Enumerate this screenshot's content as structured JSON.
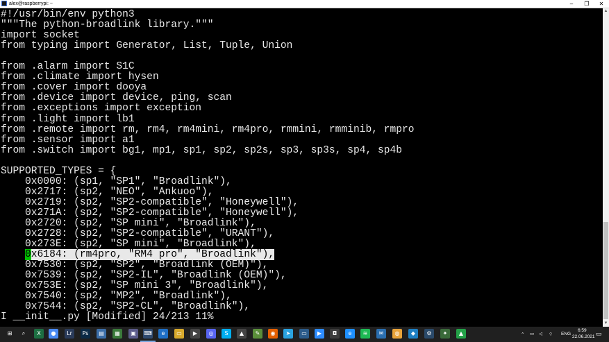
{
  "window": {
    "title": "alex@raspberrypi: ~",
    "controls": {
      "minimize": "–",
      "maximize": "❐",
      "close": "✕"
    }
  },
  "terminal": {
    "lines": [
      "#!/usr/bin/env python3",
      "\"\"\"The python-broadlink library.\"\"\"",
      "import socket",
      "from typing import Generator, List, Tuple, Union",
      "",
      "from .alarm import S1C",
      "from .climate import hysen",
      "from .cover import dooya",
      "from .device import device, ping, scan",
      "from .exceptions import exception",
      "from .light import lb1",
      "from .remote import rm, rm4, rm4mini, rm4pro, rmmini, rmminib, rmpro",
      "from .sensor import a1",
      "from .switch import bg1, mp1, sp1, sp2, sp2s, sp3, sp3s, sp4, sp4b",
      "",
      "SUPPORTED_TYPES = {",
      "    0x0000: (sp1, \"SP1\", \"Broadlink\"),",
      "    0x2717: (sp2, \"NEO\", \"Ankuoo\"),",
      "    0x2719: (sp2, \"SP2-compatible\", \"Honeywell\"),",
      "    0x271A: (sp2, \"SP2-compatible\", \"Honeywell\"),",
      "    0x2720: (sp2, \"SP mini\", \"Broadlink\"),",
      "    0x2728: (sp2, \"SP2-compatible\", \"URANT\"),",
      "    0x273E: (sp2, \"SP mini\", \"Broadlink\"),",
      "",
      "    0x7530: (sp2, \"SP2\", \"Broadlink (OEM)\"),",
      "    0x7539: (sp2, \"SP2-IL\", \"Broadlink (OEM)\"),",
      "    0x753E: (sp2, \"SP mini 3\", \"Broadlink\"),",
      "    0x7540: (sp2, \"MP2\", \"Broadlink\"),",
      "    0x7544: (sp2, \"SP2-CL\", \"Broadlink\"),"
    ],
    "selected_line": {
      "indent": "    ",
      "cursor_char": "0",
      "rest": "x6184: (rm4pro, \"RM4 pro\", \"Broadlink\"),"
    },
    "status_line": "I __init__.py [Modified] 24/213 11%"
  },
  "taskbar": {
    "icons": [
      {
        "name": "windows-start-icon",
        "glyph": "⊞",
        "color": "#202020"
      },
      {
        "name": "search-icon",
        "glyph": "⌕",
        "color": "#202020"
      },
      {
        "name": "excel-icon",
        "glyph": "X",
        "color": "#1d6f42"
      },
      {
        "name": "chrome-icon",
        "glyph": "●",
        "color": "#4a8af4"
      },
      {
        "name": "lightroom-icon",
        "glyph": "Lr",
        "color": "#2a3b5a"
      },
      {
        "name": "photoshop-icon",
        "glyph": "Ps",
        "color": "#0b2a45"
      },
      {
        "name": "file-icon",
        "glyph": "▤",
        "color": "#3b6ea8"
      },
      {
        "name": "calc-icon",
        "glyph": "▦",
        "color": "#3a7a3a"
      },
      {
        "name": "tile-icon",
        "glyph": "▣",
        "color": "#5b5b8a"
      },
      {
        "name": "putty-icon",
        "glyph": "⌨",
        "color": "#2f4a70"
      },
      {
        "name": "edge-icon",
        "glyph": "e",
        "color": "#1f6fc5"
      },
      {
        "name": "folder-icon",
        "glyph": "▭",
        "color": "#d7a92c"
      },
      {
        "name": "media-icon",
        "glyph": "▶",
        "color": "#444"
      },
      {
        "name": "discord-icon",
        "glyph": "◎",
        "color": "#5865f2"
      },
      {
        "name": "skype-icon",
        "glyph": "S",
        "color": "#00aff0"
      },
      {
        "name": "terminal-icon",
        "glyph": "▲",
        "color": "#444"
      },
      {
        "name": "notepad-icon",
        "glyph": "✎",
        "color": "#5a8f3a"
      },
      {
        "name": "firefox-icon",
        "glyph": "◉",
        "color": "#e66000"
      },
      {
        "name": "telegram-icon",
        "glyph": "➤",
        "color": "#2aa3e0"
      },
      {
        "name": "monitor-icon",
        "glyph": "▭",
        "color": "#2b5b8a"
      },
      {
        "name": "zoom-icon",
        "glyph": "▶",
        "color": "#2d8cff"
      },
      {
        "name": "camera-icon",
        "glyph": "◘",
        "color": "#3c3c3c"
      },
      {
        "name": "ie-icon",
        "glyph": "e",
        "color": "#1e90ff"
      },
      {
        "name": "spotify-icon",
        "glyph": "≋",
        "color": "#1db954"
      },
      {
        "name": "mail-icon",
        "glyph": "✉",
        "color": "#2a6fb0"
      },
      {
        "name": "browser-icon",
        "glyph": "◍",
        "color": "#e8a33a"
      },
      {
        "name": "vscode-icon",
        "glyph": "◆",
        "color": "#1e7fc2"
      },
      {
        "name": "wifi-app-icon",
        "glyph": "⚙",
        "color": "#2a4a6a"
      },
      {
        "name": "settings-icon",
        "glyph": "✦",
        "color": "#3a6a3a"
      },
      {
        "name": "green-app-icon",
        "glyph": "▲",
        "color": "#24a148"
      }
    ],
    "tray": {
      "language": "ENG",
      "time": "6:59",
      "date": "22.06.2021",
      "notifications_glyph": "▭"
    }
  }
}
